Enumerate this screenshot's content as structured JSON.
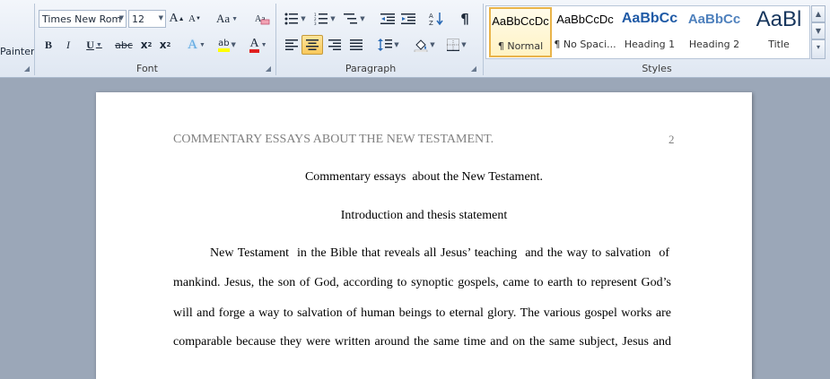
{
  "ribbon": {
    "clipboard": {
      "format_painter_fragment": "Painter"
    },
    "font": {
      "group_label": "Font",
      "font_name": "Times New Rom",
      "font_size": "12",
      "grow_font": "A",
      "shrink_font": "A",
      "change_case": "Aa",
      "bold": "B",
      "italic": "I",
      "underline": "U",
      "strikethrough": "abc",
      "subscript": "x",
      "superscript": "x",
      "text_effects": "A",
      "highlight": "ab",
      "font_color": "A"
    },
    "paragraph": {
      "group_label": "Paragraph",
      "show_marks": "¶"
    },
    "styles": {
      "group_label": "Styles",
      "items": [
        {
          "preview": "AaBbCcDc",
          "name": "¶ Normal"
        },
        {
          "preview": "AaBbCcDc",
          "name": "¶ No Spaci..."
        },
        {
          "preview": "AaBbCc",
          "name": "Heading 1"
        },
        {
          "preview": "AaBbCc",
          "name": "Heading 2"
        },
        {
          "preview": "AaBl",
          "name": "Title"
        }
      ]
    }
  },
  "document": {
    "header_text": "COMMENTARY ESSAYS ABOUT THE NEW TESTAMENT.",
    "page_number": "2",
    "title": "Commentary essays  about the New Testament.",
    "subtitle": "Introduction and thesis statement",
    "body_lines": [
      "New Testament  in the Bible that reveals all Jesus’ teaching  and the way to salvation  of",
      "mankind. Jesus, the son of God, according to synoptic gospels, came to earth to represent God’s",
      "will and forge a way to salvation  of human beings to eternal glory. The various gospel works are",
      "comparable because  they were written around the same time and on the same subject,  Jesus and"
    ]
  },
  "colors": {
    "ribbon_bg": "#dfe7f2",
    "doc_bg": "#9ba7b8",
    "selected_style": "#f9c85b",
    "heading_blue": "#1f5aa6",
    "highlight_yellow": "#ffff00",
    "font_color_red": "#e02020"
  }
}
